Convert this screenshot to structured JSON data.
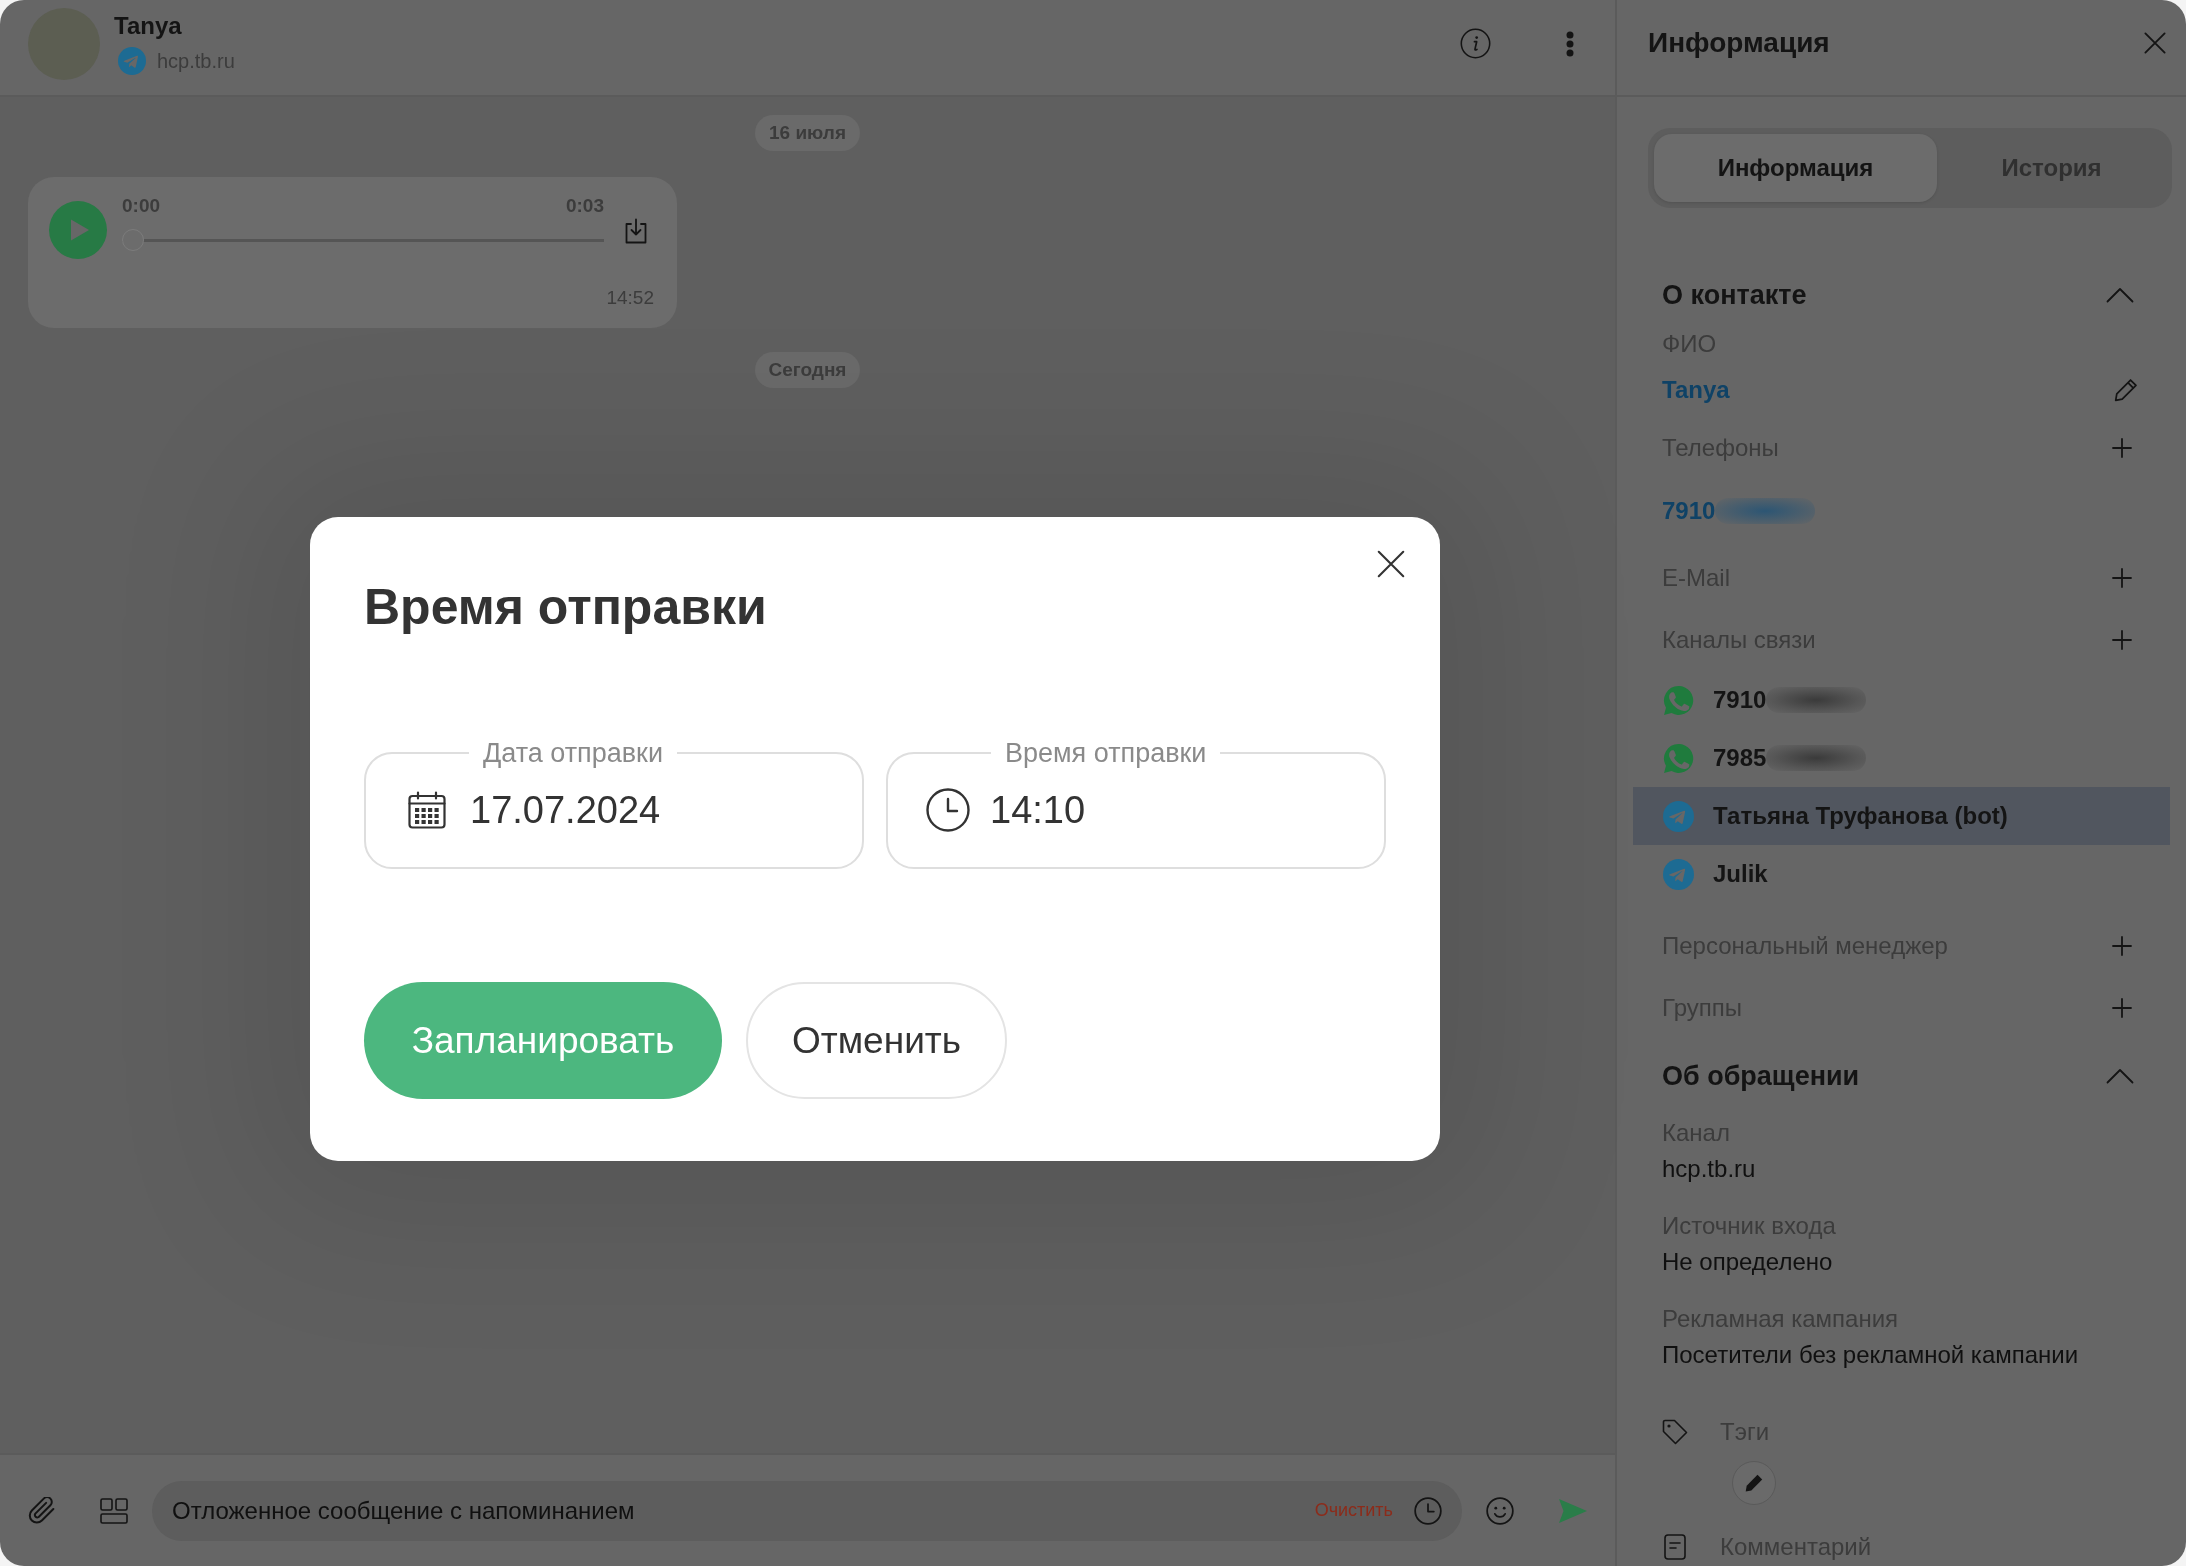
{
  "chat": {
    "contact_name": "Tanya",
    "channel": "hcp.tb.ru",
    "messages": [
      {
        "kind": "date",
        "text": "16 июля"
      },
      {
        "kind": "audio",
        "position": "0:00",
        "duration": "0:03",
        "level": 0,
        "time": "14:52"
      },
      {
        "kind": "date",
        "text": "Сегодня"
      }
    ]
  },
  "composer": {
    "value": "Отложенное сообщение с напоминанием",
    "clear_label": "Очистить"
  },
  "info_panel": {
    "title": "Информация",
    "tabs": [
      {
        "label": "Информация",
        "selected": true
      },
      {
        "label": "История",
        "selected": false
      }
    ],
    "sections": [
      {
        "title": "О контакте",
        "expanded": true,
        "rows": [
          {
            "kind": "field",
            "label": "ФИО",
            "value": "Tanya",
            "editable": true
          },
          {
            "kind": "list",
            "label": "Телефоны",
            "addable": true,
            "items": [
              {
                "text": "7910",
                "redacted": true
              }
            ]
          },
          {
            "kind": "list",
            "label": "E-Mail",
            "addable": true
          },
          {
            "kind": "channels",
            "label": "Каналы связи",
            "addable": true,
            "items": [
              {
                "kind": "whatsapp",
                "text": "7910",
                "redacted": true,
                "selected": false
              },
              {
                "kind": "whatsapp",
                "text": "7985",
                "redacted": true,
                "selected": false
              },
              {
                "kind": "telegram",
                "text": "Татьяна Труфанова (bot)",
                "selected": true
              },
              {
                "kind": "telegram",
                "text": "Julik",
                "selected": false
              }
            ]
          },
          {
            "kind": "list",
            "label": "Персональный менеджер",
            "addable": true
          },
          {
            "kind": "list",
            "label": "Группы",
            "addable": true
          }
        ]
      },
      {
        "title": "Об обращении",
        "expanded": true,
        "rows": [
          {
            "kind": "pair",
            "label": "Канал",
            "value": "hcp.tb.ru"
          },
          {
            "kind": "pair",
            "label": "Источник входа",
            "value": "Не определено"
          },
          {
            "kind": "pair",
            "label": "Рекламная кампания",
            "value": "Посетители без рекламной кампании"
          },
          {
            "kind": "tags",
            "label": "Тэги"
          },
          {
            "kind": "comment",
            "label": "Комментарий"
          }
        ]
      }
    ]
  },
  "modal": {
    "title": "Время отправки",
    "fields": [
      {
        "kind": "date",
        "label": "Дата отправки",
        "value": "17.07.2024"
      },
      {
        "kind": "time",
        "label": "Время отправки",
        "value": "14:10"
      }
    ],
    "buttons": [
      {
        "kind": "primary",
        "label": "Запланировать"
      },
      {
        "kind": "secondary",
        "label": "Отменить"
      }
    ]
  }
}
